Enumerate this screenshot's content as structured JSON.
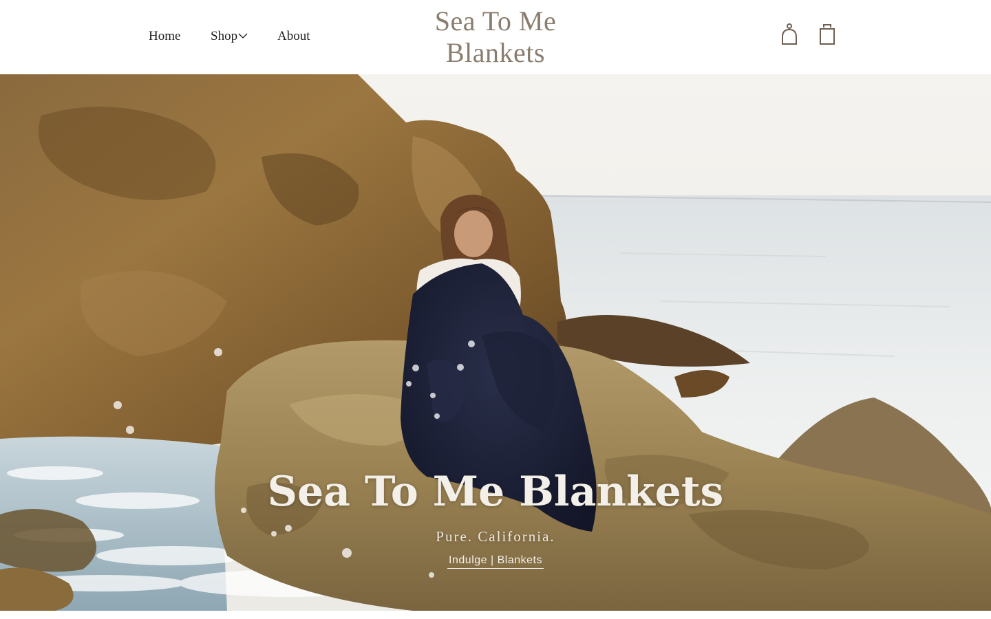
{
  "nav": {
    "home": "Home",
    "shop": "Shop",
    "about": "About"
  },
  "logo": {
    "line1": "Sea To Me",
    "line2": "Blankets"
  },
  "icons": {
    "account": "account-icon",
    "cart": "shopping-bag-icon",
    "shop_dropdown": "chevron-down-icon"
  },
  "hero": {
    "title": "Sea To Me Blankets",
    "subtitle": "Pure. California.",
    "link": "Indulge | Blankets"
  },
  "colors": {
    "logo": "#8a7d6e",
    "nav_text": "#1c1c1c",
    "icon_stroke": "#6e5d50",
    "hero_text": "#f3efe9"
  }
}
